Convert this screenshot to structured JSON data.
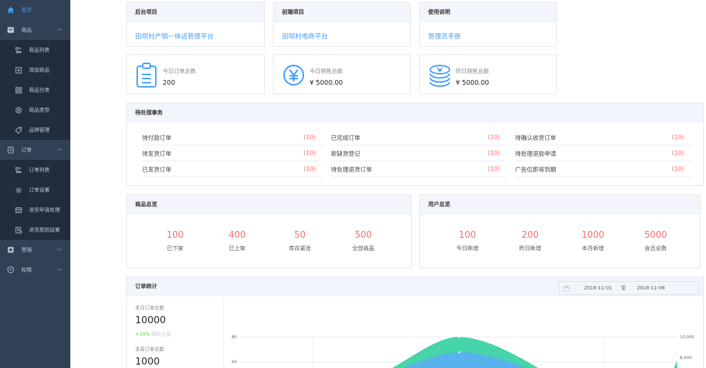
{
  "sidebar": {
    "items": [
      {
        "label": "首页",
        "icon": "home-icon",
        "active": true
      },
      {
        "label": "商品",
        "icon": "goods-icon",
        "expanded": true,
        "children": [
          {
            "label": "商品列表",
            "icon": "list-icon"
          },
          {
            "label": "添加商品",
            "icon": "add-icon"
          },
          {
            "label": "商品分类",
            "icon": "grid-icon"
          },
          {
            "label": "商品类型",
            "icon": "type-icon"
          },
          {
            "label": "品牌管理",
            "icon": "tag-icon"
          }
        ]
      },
      {
        "label": "订单",
        "icon": "order-icon",
        "expanded": true,
        "children": [
          {
            "label": "订单列表",
            "icon": "list-icon"
          },
          {
            "label": "订单设置",
            "icon": "gear-icon"
          },
          {
            "label": "退货申请处理",
            "icon": "return-icon"
          },
          {
            "label": "退货原因设置",
            "icon": "reason-icon"
          }
        ]
      },
      {
        "label": "营销",
        "icon": "marketing-icon"
      },
      {
        "label": "权限",
        "icon": "shield-icon"
      }
    ]
  },
  "projects": [
    {
      "title": "后台项目",
      "link": "田坝村产销一体话管理平台"
    },
    {
      "title": "前端项目",
      "link": "田坝村电商平台"
    },
    {
      "title": "使用说明",
      "link": "管理员手册"
    }
  ],
  "stats": [
    {
      "label": "今日订单总数",
      "value": "200",
      "icon": "order-doc-icon"
    },
    {
      "label": "今日销售总额",
      "value": "¥ 5000.00",
      "icon": "yen-icon"
    },
    {
      "label": "昨日销售总额",
      "value": "¥ 5000.00",
      "icon": "coins-icon"
    }
  ],
  "pending": {
    "title": "待处理事务",
    "columns": [
      [
        {
          "label": "待付款订单",
          "count": "(10)"
        },
        {
          "label": "待发货订单",
          "count": "(10)"
        },
        {
          "label": "已发货订单",
          "count": "(10)"
        }
      ],
      [
        {
          "label": "已完成订单",
          "count": "(10)"
        },
        {
          "label": "新缺货登记",
          "count": "(10)"
        },
        {
          "label": "待处理退货订单",
          "count": "(10)"
        }
      ],
      [
        {
          "label": "待确认收货订单",
          "count": "(10)"
        },
        {
          "label": "待处理退款申请",
          "count": "(10)"
        },
        {
          "label": "广告位即将到期",
          "count": "(10)"
        }
      ]
    ]
  },
  "goods_overview": {
    "title": "商品总览",
    "items": [
      {
        "value": "100",
        "label": "已下架"
      },
      {
        "value": "400",
        "label": "已上架"
      },
      {
        "value": "50",
        "label": "库存紧张"
      },
      {
        "value": "500",
        "label": "全部商品"
      }
    ]
  },
  "user_overview": {
    "title": "用户总览",
    "items": [
      {
        "value": "100",
        "label": "今日新增"
      },
      {
        "value": "200",
        "label": "昨日新增"
      },
      {
        "value": "1000",
        "label": "本月新增"
      },
      {
        "value": "5000",
        "label": "会员总数"
      }
    ]
  },
  "order_stats": {
    "title": "订单统计",
    "month_label": "本月订单总数",
    "month_value": "10000",
    "month_change": "+10%",
    "month_compare": "同比上月",
    "week_label": "本周订单总数",
    "week_value": "1000",
    "date_from": "2018-11-01",
    "date_sep": "至",
    "date_to": "2018-11-08",
    "y_left_ticks": [
      "80",
      "60"
    ],
    "y_right_ticks": [
      "10,000",
      "8,000"
    ]
  },
  "colors": {
    "accent": "#409eff",
    "sidebar_bg": "#304156",
    "submenu_bg": "#1f2d3d",
    "count_red": "#f56c6c",
    "area_green": "#3cd2a5",
    "area_blue": "#5ab1ef"
  }
}
